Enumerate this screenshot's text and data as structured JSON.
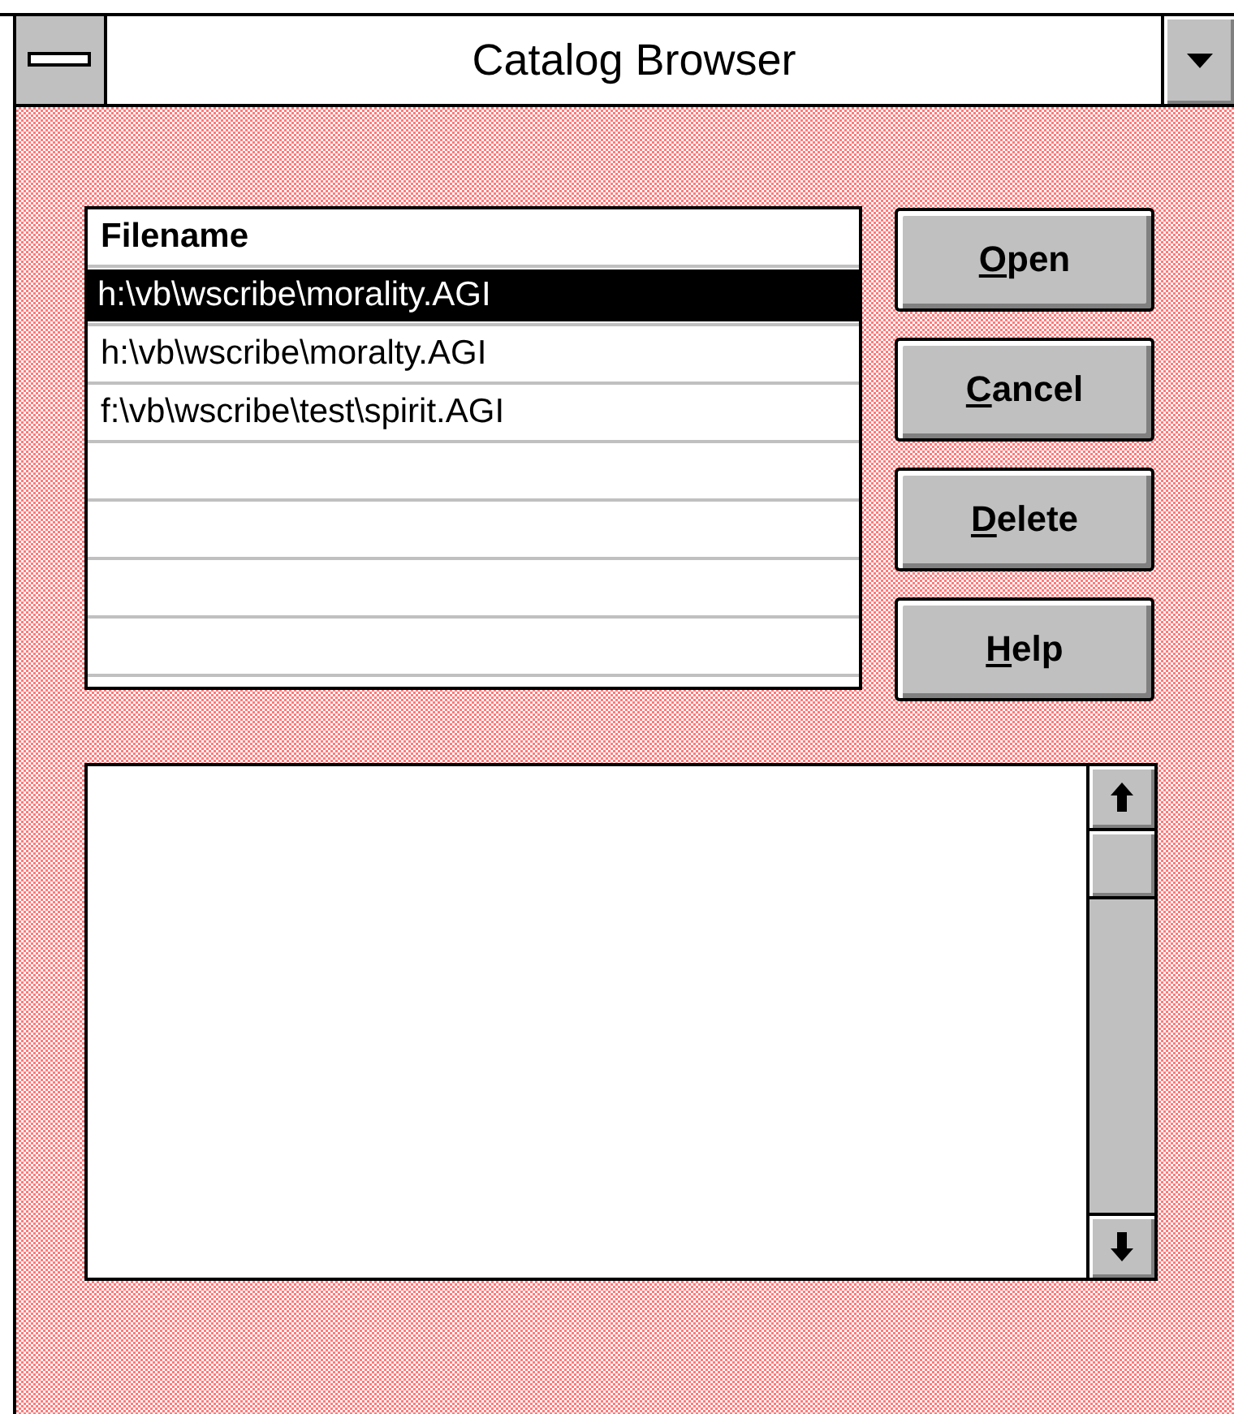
{
  "window": {
    "title": "Catalog Browser"
  },
  "file_list": {
    "header": "Filename",
    "rows": [
      {
        "text": "h:\\vb\\wscribe\\morality.AGI",
        "selected": true
      },
      {
        "text": "h:\\vb\\wscribe\\moralty.AGI",
        "selected": false
      },
      {
        "text": "f:\\vb\\wscribe\\test\\spirit.AGI",
        "selected": false
      }
    ]
  },
  "buttons": [
    {
      "label": "Open",
      "mnemonic_underlined": true
    },
    {
      "label": "Cancel",
      "mnemonic_underlined": true
    },
    {
      "label": "Delete",
      "mnemonic_underlined": true
    },
    {
      "label": "Help",
      "mnemonic_underlined": true
    }
  ]
}
